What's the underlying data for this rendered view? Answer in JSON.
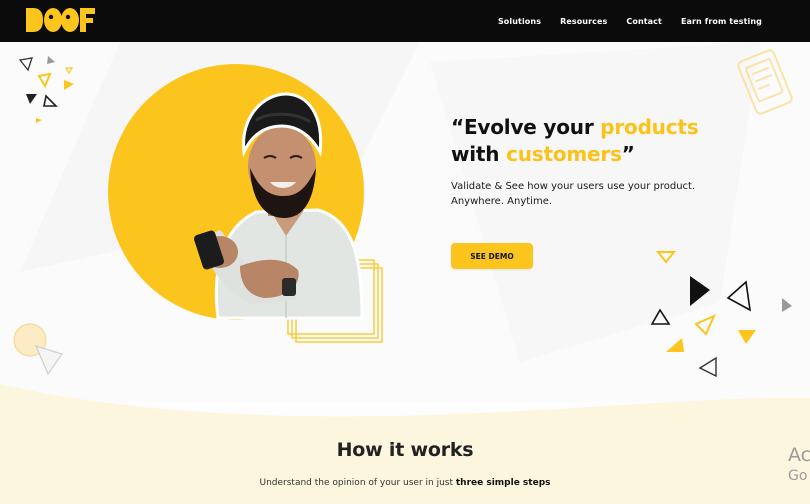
{
  "brand": {
    "logo_text": "DOOF",
    "accent": "#fcc51e",
    "nav_bg": "#0b0b0b"
  },
  "nav": {
    "links": [
      "Solutions",
      "Resources",
      "Contact",
      "Earn from testing"
    ]
  },
  "hero": {
    "headline_open": "“Evolve your ",
    "headline_accent1": "products",
    "headline_with": "with ",
    "headline_accent2": "customers",
    "headline_close": "”",
    "sub_line1": "Validate & See how your users use your product.",
    "sub_line2": "Anywhere. Anytime.",
    "cta_label": "SEE DEMO"
  },
  "how": {
    "title": "How it works",
    "sub_prefix": "Understand the opinion of your user in just ",
    "sub_bold": "three simple steps"
  },
  "watermark": {
    "line1": "Ac",
    "line2": "Go"
  }
}
